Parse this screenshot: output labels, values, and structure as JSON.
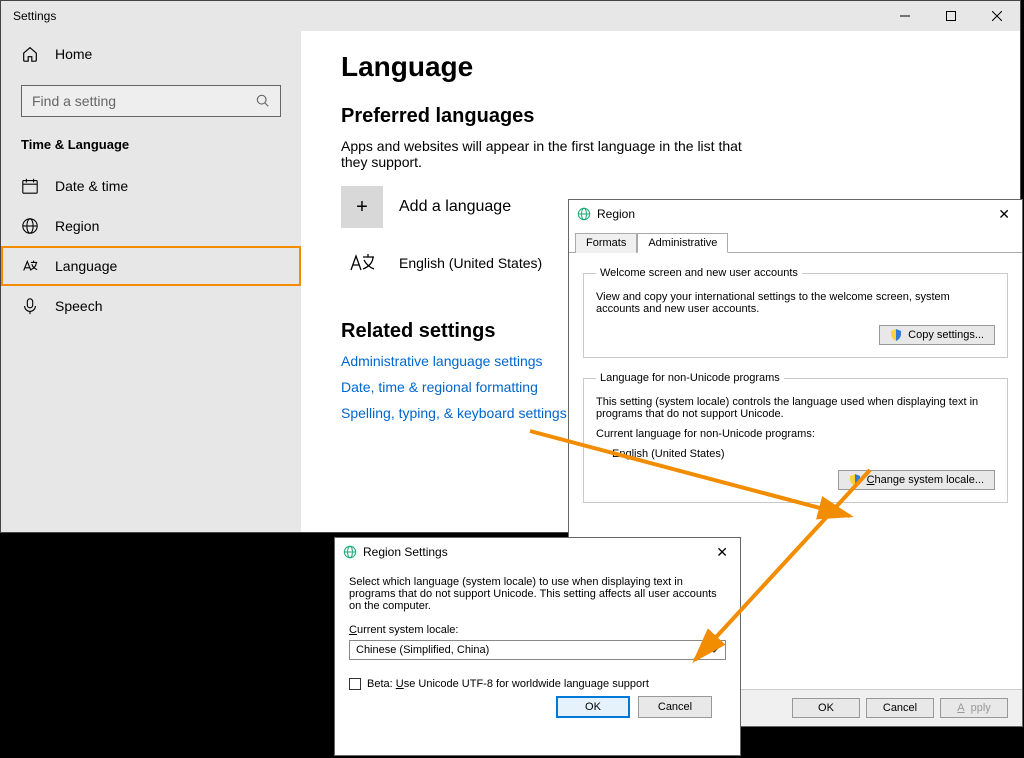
{
  "settings": {
    "window_title": "Settings",
    "home_label": "Home",
    "search_placeholder": "Find a setting",
    "section": "Time & Language",
    "nav": {
      "date": "Date & time",
      "region": "Region",
      "language": "Language",
      "speech": "Speech"
    },
    "page_title": "Language",
    "preferred_heading": "Preferred languages",
    "preferred_desc": "Apps and websites will appear in the first language in the list that they support.",
    "add_language": "Add a language",
    "lang_item": "English (United States)",
    "related_heading": "Related settings",
    "links": {
      "admin": "Administrative language settings",
      "datetime": "Date, time & regional formatting",
      "spelling": "Spelling, typing, & keyboard settings"
    }
  },
  "region": {
    "title": "Region",
    "tabs": {
      "formats": "Formats",
      "admin": "Administrative"
    },
    "welcome_legend": "Welcome screen and new user accounts",
    "welcome_text": "View and copy your international settings to the welcome screen, system accounts and new user accounts.",
    "copy_settings": "Copy settings...",
    "nonuni_legend": "Language for non-Unicode programs",
    "nonuni_text": "This setting (system locale) controls the language used when displaying text in programs that do not support Unicode.",
    "current_label": "Current language for non-Unicode programs:",
    "current_value": "English (United States)",
    "change_locale": "Change system locale...",
    "ok": "OK",
    "cancel": "Cancel",
    "apply": "Apply"
  },
  "region_settings": {
    "title": "Region Settings",
    "desc": "Select which language (system locale) to use when displaying text in programs that do not support Unicode. This setting affects all user accounts on the computer.",
    "current_label": "Current system locale:",
    "select_value": "Chinese (Simplified, China)",
    "beta_prefix": "Beta: ",
    "beta_label": "se Unicode UTF-8 for worldwide language support",
    "beta_u": "U",
    "ok": "OK",
    "cancel": "Cancel"
  }
}
